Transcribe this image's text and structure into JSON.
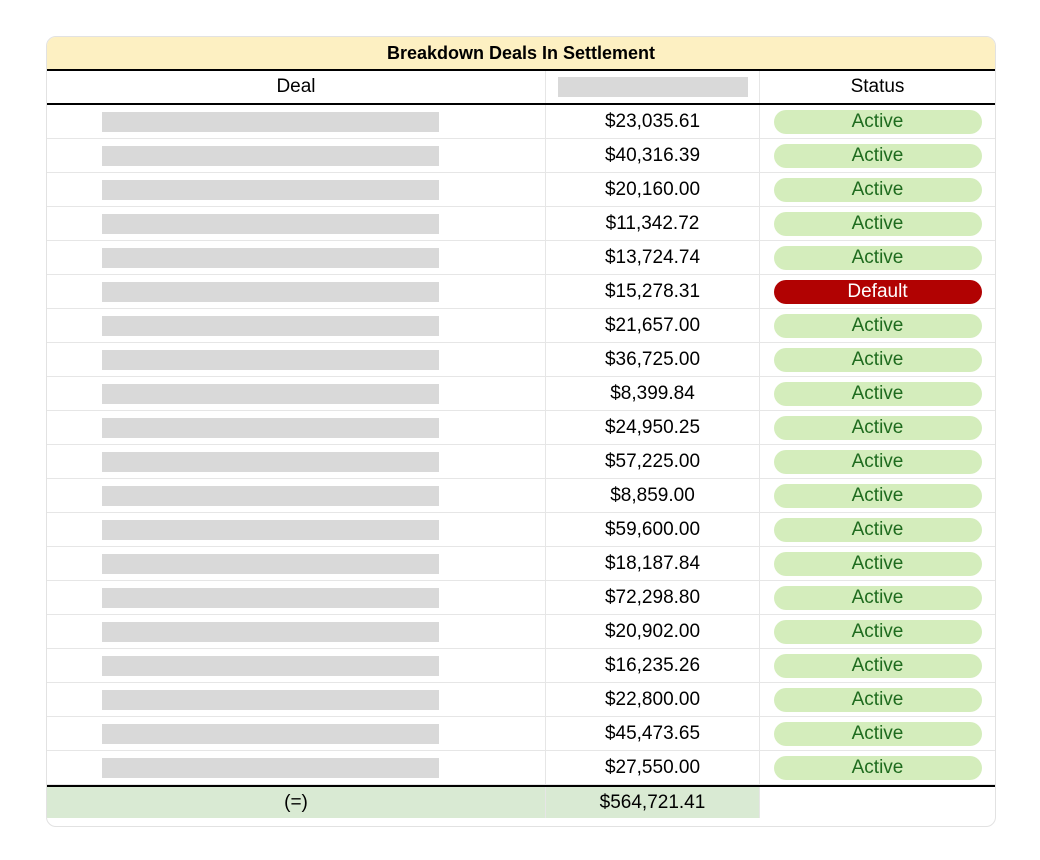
{
  "table": {
    "title": "Breakdown Deals In Settlement",
    "headers": {
      "deal": "Deal",
      "amount": "",
      "status": "Status"
    },
    "rows": [
      {
        "amount": "$23,035.61",
        "status": "Active"
      },
      {
        "amount": "$40,316.39",
        "status": "Active"
      },
      {
        "amount": "$20,160.00",
        "status": "Active"
      },
      {
        "amount": "$11,342.72",
        "status": "Active"
      },
      {
        "amount": "$13,724.74",
        "status": "Active"
      },
      {
        "amount": "$15,278.31",
        "status": "Default"
      },
      {
        "amount": "$21,657.00",
        "status": "Active"
      },
      {
        "amount": "$36,725.00",
        "status": "Active"
      },
      {
        "amount": "$8,399.84",
        "status": "Active"
      },
      {
        "amount": "$24,950.25",
        "status": "Active"
      },
      {
        "amount": "$57,225.00",
        "status": "Active"
      },
      {
        "amount": "$8,859.00",
        "status": "Active"
      },
      {
        "amount": "$59,600.00",
        "status": "Active"
      },
      {
        "amount": "$18,187.84",
        "status": "Active"
      },
      {
        "amount": "$72,298.80",
        "status": "Active"
      },
      {
        "amount": "$20,902.00",
        "status": "Active"
      },
      {
        "amount": "$16,235.26",
        "status": "Active"
      },
      {
        "amount": "$22,800.00",
        "status": "Active"
      },
      {
        "amount": "$45,473.65",
        "status": "Active"
      },
      {
        "amount": "$27,550.00",
        "status": "Active"
      }
    ],
    "total": {
      "label": "(=)",
      "amount": "$564,721.41"
    }
  },
  "colors": {
    "title_bg": "#fdf0c2",
    "active_bg": "#d4edbc",
    "active_text": "#1e6b1e",
    "default_bg": "#b10202",
    "default_text": "#ffffff",
    "total_bg": "#d9ead3",
    "redaction": "#d9d9d9"
  }
}
